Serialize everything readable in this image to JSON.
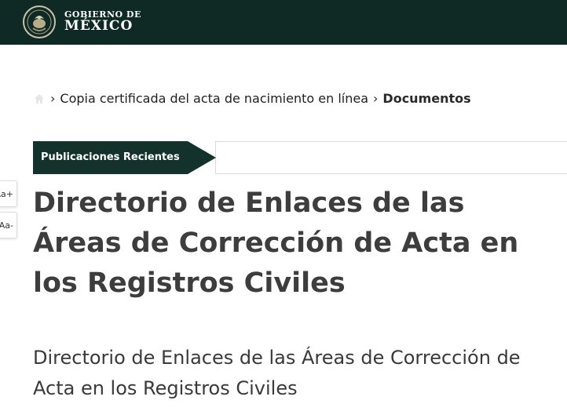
{
  "header": {
    "logo_line1": "GOBIERNO DE",
    "logo_line2": "MÉXICO",
    "background_color": "#0f2a24"
  },
  "breadcrumb": {
    "home_icon": "home-icon",
    "items": [
      {
        "label": "Copia certificada del acta de nacimiento en línea"
      },
      {
        "label": "Documentos"
      }
    ],
    "separator": "›"
  },
  "publications_tab": {
    "label": "Publicaciones Recientes",
    "color": "#13322b"
  },
  "font_controls": {
    "increase_label": "Aa+",
    "decrease_label": "Aa-"
  },
  "main": {
    "title": "Directorio de Enlaces de las Áreas de Corrección de Acta en los Registros Civiles",
    "subtitle": "Directorio de Enlaces de las Áreas de Corrección de Acta en los Registros Civiles"
  }
}
